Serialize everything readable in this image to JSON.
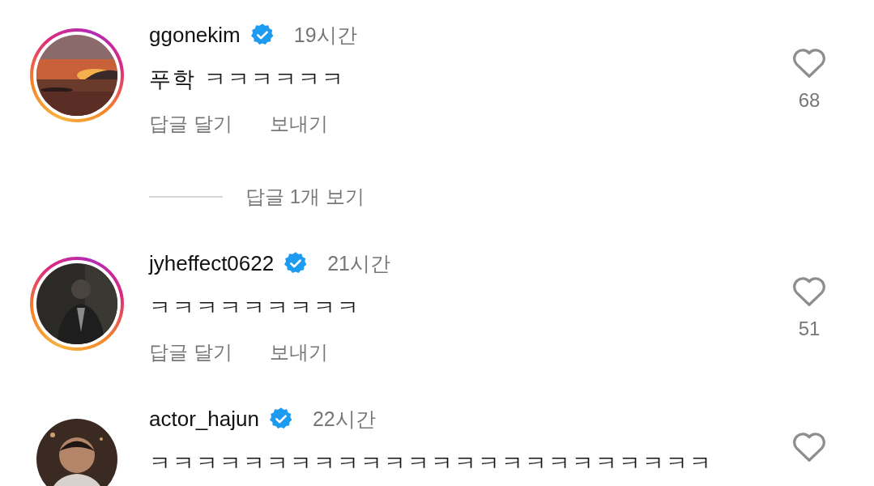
{
  "comments": [
    {
      "username": "ggonekim",
      "verified": true,
      "time": "19시간",
      "text": "푸학 ㅋㅋㅋㅋㅋㅋ",
      "actions": [
        "답글 달기",
        "보내기"
      ],
      "likes": "68",
      "liked": false,
      "story": true,
      "picture": {
        "kind": "picture"
      },
      "view_replies": "답글 1개 보기"
    },
    {
      "username": "jyheffect0622",
      "verified": true,
      "time": "21시간",
      "text": "ㅋㅋㅋㅋㅋㅋㅋㅋㅋ",
      "actions": [
        "답글 달기",
        "보내기"
      ],
      "likes": "51",
      "liked": false,
      "story": true,
      "picture": {
        "kind": "picture"
      }
    },
    {
      "username": "actor_hajun",
      "verified": true,
      "time": "22시간",
      "text": "ㅋㅋㅋㅋㅋㅋㅋㅋㅋㅋㅋㅋㅋㅋㅋㅋㅋㅋㅋㅋㅋㅋㅋㅋ",
      "liked": false,
      "story": false,
      "picture": {
        "kind": "picture"
      }
    }
  ]
}
